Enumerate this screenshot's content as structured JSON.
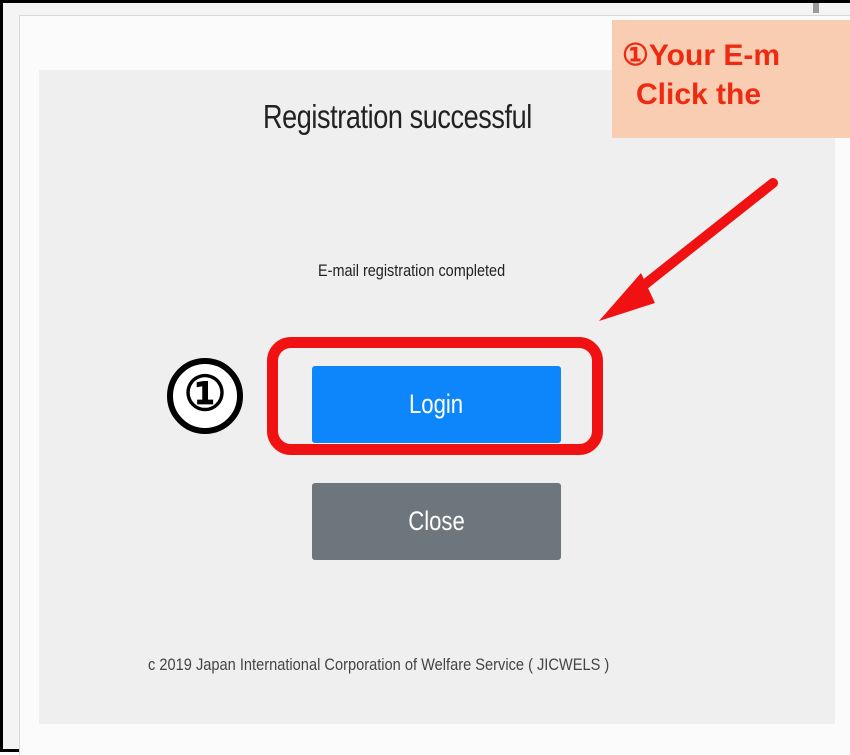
{
  "dialog": {
    "title": "Registration successful",
    "message": "E-mail registration completed",
    "login_label": "Login",
    "close_label": "Close",
    "footer": "c 2019 Japan International Corporation of Welfare Service ( JICWELS )"
  },
  "annotation": {
    "step_marker": "①",
    "callout_line1": "①Your E-m",
    "callout_line2": "Click the",
    "colors": {
      "highlight": "#f01212",
      "callout_bg": "#f8cdb1",
      "callout_text": "#ee2a12",
      "arrow": "#f01212"
    },
    "icons": {
      "arrow": "arrow-down-left-icon"
    }
  },
  "colors": {
    "login_button": "#0d86fc",
    "close_button": "#6d757d",
    "panel": "#efefef"
  }
}
